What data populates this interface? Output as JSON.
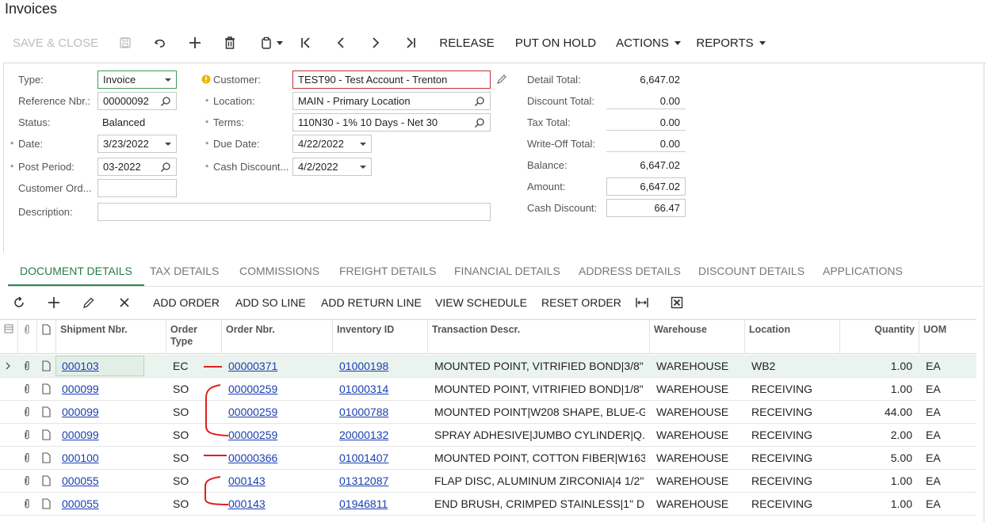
{
  "page": {
    "title": "Invoices"
  },
  "toolbar": {
    "save_close": "SAVE & CLOSE",
    "release": "RELEASE",
    "put_on_hold": "PUT ON HOLD",
    "actions": "ACTIONS",
    "reports": "REPORTS"
  },
  "form": {
    "type": {
      "label": "Type:",
      "value": "Invoice"
    },
    "ref_nbr": {
      "label": "Reference Nbr.:",
      "value": "00000092"
    },
    "status": {
      "label": "Status:",
      "value": "Balanced"
    },
    "date": {
      "label": "Date:",
      "value": "3/23/2022"
    },
    "post_period": {
      "label": "Post Period:",
      "value": "03-2022"
    },
    "customer_ord": {
      "label": "Customer Ord...",
      "value": ""
    },
    "description": {
      "label": "Description:",
      "value": ""
    },
    "customer": {
      "label": "Customer:",
      "value": "TEST90 - Test Account - Trenton"
    },
    "location": {
      "label": "Location:",
      "value": "MAIN - Primary Location"
    },
    "terms": {
      "label": "Terms:",
      "value": "110N30 - 1% 10 Days - Net 30"
    },
    "due_date": {
      "label": "Due Date:",
      "value": "4/22/2022"
    },
    "cash_discount_date": {
      "label": "Cash Discount...",
      "value": "4/2/2022"
    }
  },
  "totals": {
    "detail_total": {
      "label": "Detail Total:",
      "value": "6,647.02"
    },
    "discount_total": {
      "label": "Discount Total:",
      "value": "0.00"
    },
    "tax_total": {
      "label": "Tax Total:",
      "value": "0.00"
    },
    "writeoff_total": {
      "label": "Write-Off Total:",
      "value": "0.00"
    },
    "balance": {
      "label": "Balance:",
      "value": "6,647.02"
    },
    "amount": {
      "label": "Amount:",
      "value": "6,647.02"
    },
    "cash_discount": {
      "label": "Cash Discount:",
      "value": "66.47"
    }
  },
  "tabs": [
    "DOCUMENT DETAILS",
    "TAX DETAILS",
    "COMMISSIONS",
    "FREIGHT DETAILS",
    "FINANCIAL DETAILS",
    "ADDRESS DETAILS",
    "DISCOUNT DETAILS",
    "APPLICATIONS"
  ],
  "grid_toolbar": {
    "add_order": "ADD ORDER",
    "add_so_line": "ADD SO LINE",
    "add_return_line": "ADD RETURN LINE",
    "view_schedule": "VIEW SCHEDULE",
    "reset_order": "RESET ORDER"
  },
  "grid": {
    "columns": {
      "shipment": "Shipment Nbr.",
      "order_type": "Order Type",
      "order_nbr": "Order Nbr.",
      "inventory": "Inventory ID",
      "descr": "Transaction Descr.",
      "warehouse": "Warehouse",
      "location": "Location",
      "quantity": "Quantity",
      "uom": "UOM"
    },
    "rows": [
      {
        "shipment": "000103",
        "order_type": "EC",
        "order_nbr": "00000371",
        "inventory": "01000198",
        "descr": "MOUNTED POINT, VITRIFIED BOND|3/8\" ...",
        "warehouse": "WAREHOUSE",
        "location": "WB2",
        "quantity": "1.00",
        "uom": "EA"
      },
      {
        "shipment": "000099",
        "order_type": "SO",
        "order_nbr": "00000259",
        "inventory": "01000314",
        "descr": "MOUNTED POINT, VITRIFIED BOND|1/8\" ...",
        "warehouse": "WAREHOUSE",
        "location": "RECEIVING",
        "quantity": "1.00",
        "uom": "EA"
      },
      {
        "shipment": "000099",
        "order_type": "SO",
        "order_nbr": "00000259",
        "inventory": "01000788",
        "descr": "MOUNTED POINT|W208 SHAPE, BLUE-G...",
        "warehouse": "WAREHOUSE",
        "location": "RECEIVING",
        "quantity": "44.00",
        "uom": "EA"
      },
      {
        "shipment": "000099",
        "order_type": "SO",
        "order_nbr": "00000259",
        "inventory": "20000132",
        "descr": "SPRAY ADHESIVE|JUMBO CYLINDER|Q...",
        "warehouse": "WAREHOUSE",
        "location": "RECEIVING",
        "quantity": "2.00",
        "uom": "EA"
      },
      {
        "shipment": "000100",
        "order_type": "SO",
        "order_nbr": "00000366",
        "inventory": "01001407",
        "descr": "MOUNTED POINT, COTTON FIBER|W163...",
        "warehouse": "WAREHOUSE",
        "location": "RECEIVING",
        "quantity": "5.00",
        "uom": "EA"
      },
      {
        "shipment": "000055",
        "order_type": "SO",
        "order_nbr": "000143",
        "inventory": "01312087",
        "descr": "FLAP DISC, ALUMINUM ZIRCONIA|4 1/2\" ...",
        "warehouse": "WAREHOUSE",
        "location": "RECEIVING",
        "quantity": "1.00",
        "uom": "EA"
      },
      {
        "shipment": "000055",
        "order_type": "SO",
        "order_nbr": "000143",
        "inventory": "01946811",
        "descr": "END BRUSH, CRIMPED STAINLESS|1\" DI...",
        "warehouse": "WAREHOUSE",
        "location": "RECEIVING",
        "quantity": "1.00",
        "uom": "EA"
      }
    ]
  },
  "colors": {
    "accent": "#2a8a4a",
    "link": "#1a3fb0",
    "annotation": "#e0201c",
    "warning": "#f0b400"
  }
}
